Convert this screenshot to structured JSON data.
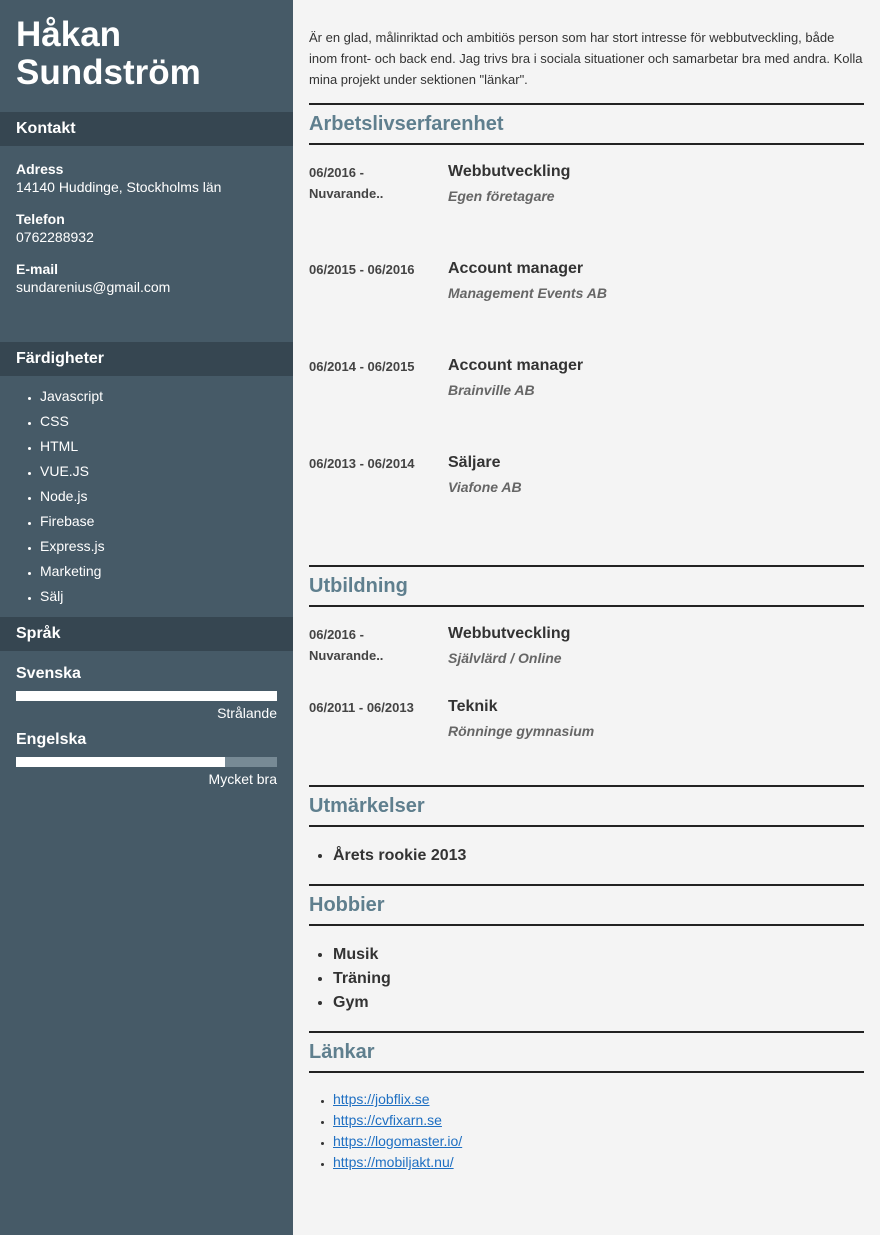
{
  "name": {
    "first": "Håkan",
    "last": "Sundström"
  },
  "sidebar": {
    "contact_title": "Kontakt",
    "address_label": "Adress",
    "address_value": "14140 Huddinge, Stockholms län",
    "phone_label": "Telefon",
    "phone_value": "0762288932",
    "email_label": "E-mail",
    "email_value": "sundarenius@gmail.com",
    "skills_title": "Färdigheter",
    "skills": [
      "Javascript",
      "CSS",
      "HTML",
      "VUE.JS",
      "Node.js",
      "Firebase",
      "Express.js",
      "Marketing",
      "Sälj"
    ],
    "languages_title": "Språk",
    "languages": [
      {
        "name": "Svenska",
        "level": "Strålande",
        "proficiency": 1.0
      },
      {
        "name": "Engelska",
        "level": "Mycket bra",
        "proficiency": 0.8
      }
    ]
  },
  "intro": "Är en glad, målinriktad och ambitiös person som har stort intresse för webbutveckling, både inom front- och back end. Jag trivs bra i sociala situationer och samarbetar bra med andra. Kolla mina projekt under sektionen \"länkar\".",
  "work": {
    "title": "Arbetslivserfarenhet",
    "items": [
      {
        "date_line1": "06/2016 -",
        "date_line2": "Nuvarande..",
        "title": "Webbutveckling",
        "org": "Egen företagare"
      },
      {
        "date_line1": "06/2015 - 06/2016",
        "date_line2": "",
        "title": "Account manager",
        "org": "Management Events AB"
      },
      {
        "date_line1": "06/2014 - 06/2015",
        "date_line2": "",
        "title": "Account manager",
        "org": "Brainville AB"
      },
      {
        "date_line1": "06/2013 - 06/2014",
        "date_line2": "",
        "title": "Säljare",
        "org": "Viafone AB"
      }
    ]
  },
  "education": {
    "title": "Utbildning",
    "items": [
      {
        "date_line1": "06/2016 -",
        "date_line2": "Nuvarande..",
        "title": "Webbutveckling",
        "org": "Självlärd / Online"
      },
      {
        "date_line1": "06/2011 - 06/2013",
        "date_line2": "",
        "title": "Teknik",
        "org": "Rönninge gymnasium"
      }
    ]
  },
  "awards": {
    "title": "Utmärkelser",
    "items": [
      "Årets rookie 2013"
    ]
  },
  "hobbies": {
    "title": "Hobbier",
    "items": [
      "Musik",
      "Träning",
      "Gym"
    ]
  },
  "links": {
    "title": "Länkar",
    "items": [
      "https://jobflix.se",
      "https://cvfixarn.se",
      "https://logomaster.io/",
      "https://mobiljakt.nu/"
    ]
  }
}
